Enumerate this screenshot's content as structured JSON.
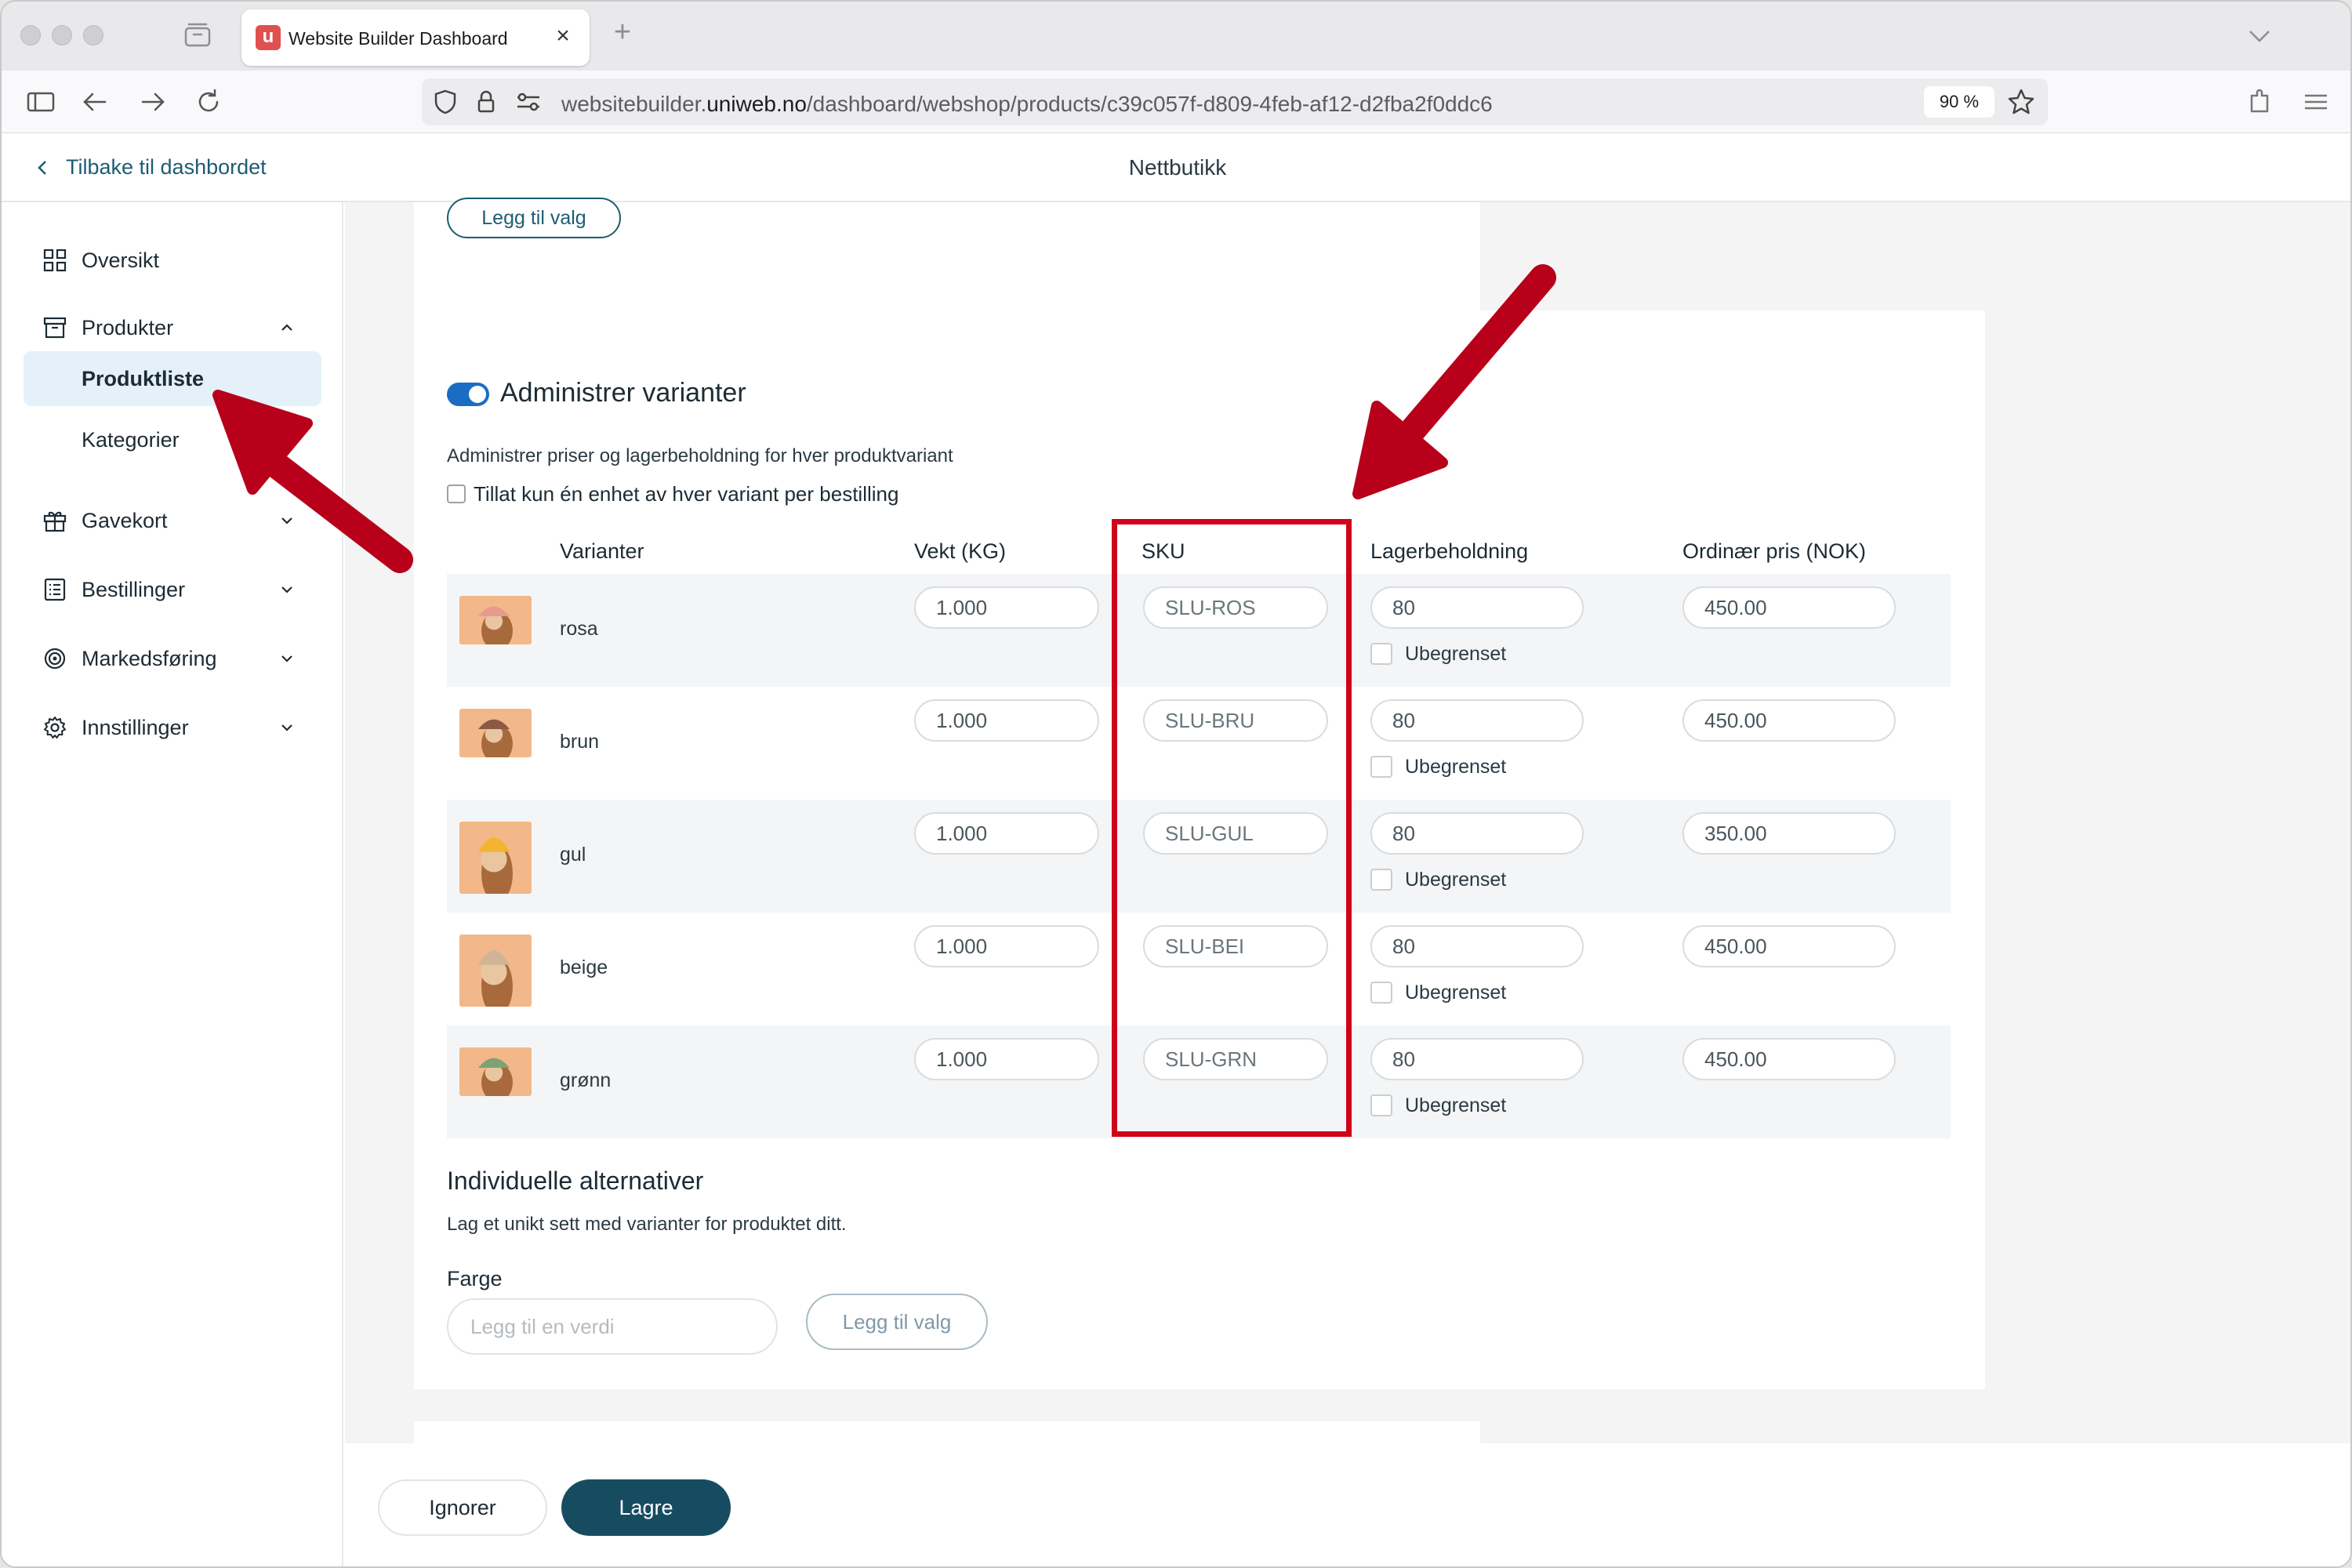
{
  "browser": {
    "tab_title": "Website Builder Dashboard",
    "tab_favicon": "u",
    "tab_close": "×",
    "new_tab": "+",
    "url_prefix": "websitebuilder.",
    "url_domain": "uniweb.no",
    "url_path": "/dashboard/webshop/products/c39c057f-d809-4feb-af12-d2fba2f0ddc6",
    "zoom": "90 %"
  },
  "header": {
    "back_label": "Tilbake til dashbordet",
    "title": "Nettbutikk"
  },
  "sidebar": {
    "items": [
      {
        "label": "Oversikt",
        "icon": "grid-icon"
      },
      {
        "label": "Produkter",
        "icon": "archive-icon"
      },
      {
        "label": "Gavekort",
        "icon": "gift-icon"
      },
      {
        "label": "Bestillinger",
        "icon": "list-icon"
      },
      {
        "label": "Markedsføring",
        "icon": "target-icon"
      },
      {
        "label": "Innstillinger",
        "icon": "gear-icon"
      }
    ],
    "sub_items": [
      {
        "label": "Produktliste",
        "active": true
      },
      {
        "label": "Kategorier",
        "active": false
      }
    ]
  },
  "top_card": {
    "add_option_label": "Legg til valg"
  },
  "variants": {
    "title": "Administrer varianter",
    "enabled": true,
    "description": "Administrer priser og lagerbeholdning for hver produktvariant",
    "single_unit_label": "Tillat kun én enhet av hver variant per bestilling",
    "columns": {
      "name": "Varianter",
      "weight": "Vekt (KG)",
      "sku": "SKU",
      "stock": "Lagerbeholdning",
      "price": "Ordinær pris (NOK)"
    },
    "unlimited_label": "Ubegrenset",
    "rows": [
      {
        "name": "rosa",
        "weight": "1.000",
        "sku": "SLU-ROS",
        "stock": "80",
        "price": "450.00",
        "hat_color": "#e79a8e"
      },
      {
        "name": "brun",
        "weight": "1.000",
        "sku": "SLU-BRU",
        "stock": "80",
        "price": "450.00",
        "hat_color": "#8a5a44"
      },
      {
        "name": "gul",
        "weight": "1.000",
        "sku": "SLU-GUL",
        "stock": "80",
        "price": "350.00",
        "hat_color": "#f2b431"
      },
      {
        "name": "beige",
        "weight": "1.000",
        "sku": "SLU-BEI",
        "stock": "80",
        "price": "450.00",
        "hat_color": "#cfb596"
      },
      {
        "name": "grønn",
        "weight": "1.000",
        "sku": "SLU-GRN",
        "stock": "80",
        "price": "450.00",
        "hat_color": "#7fa274"
      }
    ]
  },
  "individual": {
    "title": "Individuelle alternativer",
    "description": "Lag et unikt sett med varianter for produktet ditt.",
    "color_label": "Farge",
    "color_placeholder": "Legg til en verdi",
    "add_option_label": "Legg til valg"
  },
  "footer": {
    "ignore_label": "Ignorer",
    "save_label": "Lagre"
  },
  "colors": {
    "accent": "#174c60",
    "toggle": "#1a6dc2",
    "annotation": "#d0021b"
  }
}
